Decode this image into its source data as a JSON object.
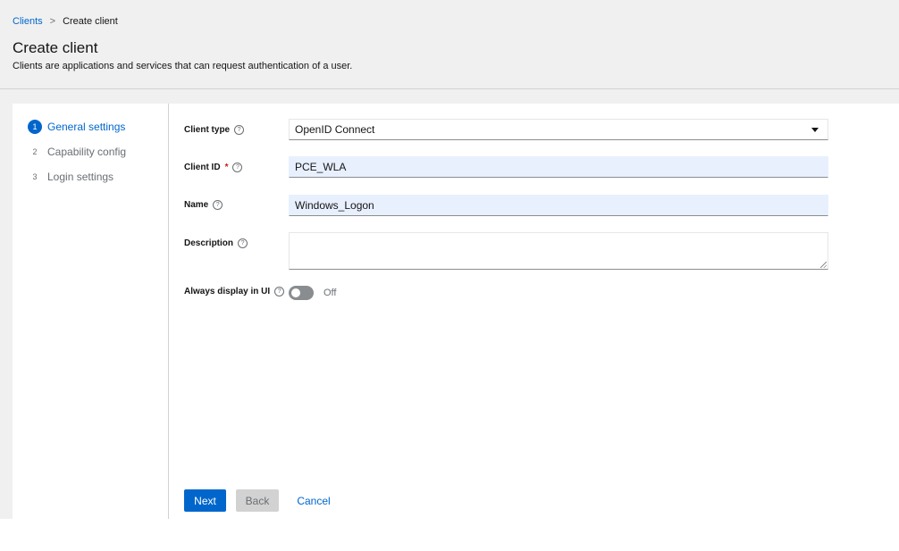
{
  "breadcrumb": {
    "parent": "Clients",
    "separator": ">",
    "current": "Create client"
  },
  "header": {
    "title": "Create client",
    "description": "Clients are applications and services that can request authentication of a user."
  },
  "wizard": {
    "steps": [
      {
        "number": "1",
        "label": "General settings",
        "active": true
      },
      {
        "number": "2",
        "label": "Capability config",
        "active": false
      },
      {
        "number": "3",
        "label": "Login settings",
        "active": false
      }
    ]
  },
  "form": {
    "client_type": {
      "label": "Client type",
      "value": "OpenID Connect"
    },
    "client_id": {
      "label": "Client ID",
      "required_mark": "*",
      "value": "PCE_WLA"
    },
    "name": {
      "label": "Name",
      "value": "Windows_Logon"
    },
    "description": {
      "label": "Description",
      "value": ""
    },
    "always_display": {
      "label": "Always display in UI",
      "state": "Off"
    }
  },
  "actions": {
    "next": "Next",
    "back": "Back",
    "cancel": "Cancel"
  },
  "colors": {
    "accent": "#0066cc",
    "required": "#c9190b",
    "autofill": "#e8f0fe"
  }
}
